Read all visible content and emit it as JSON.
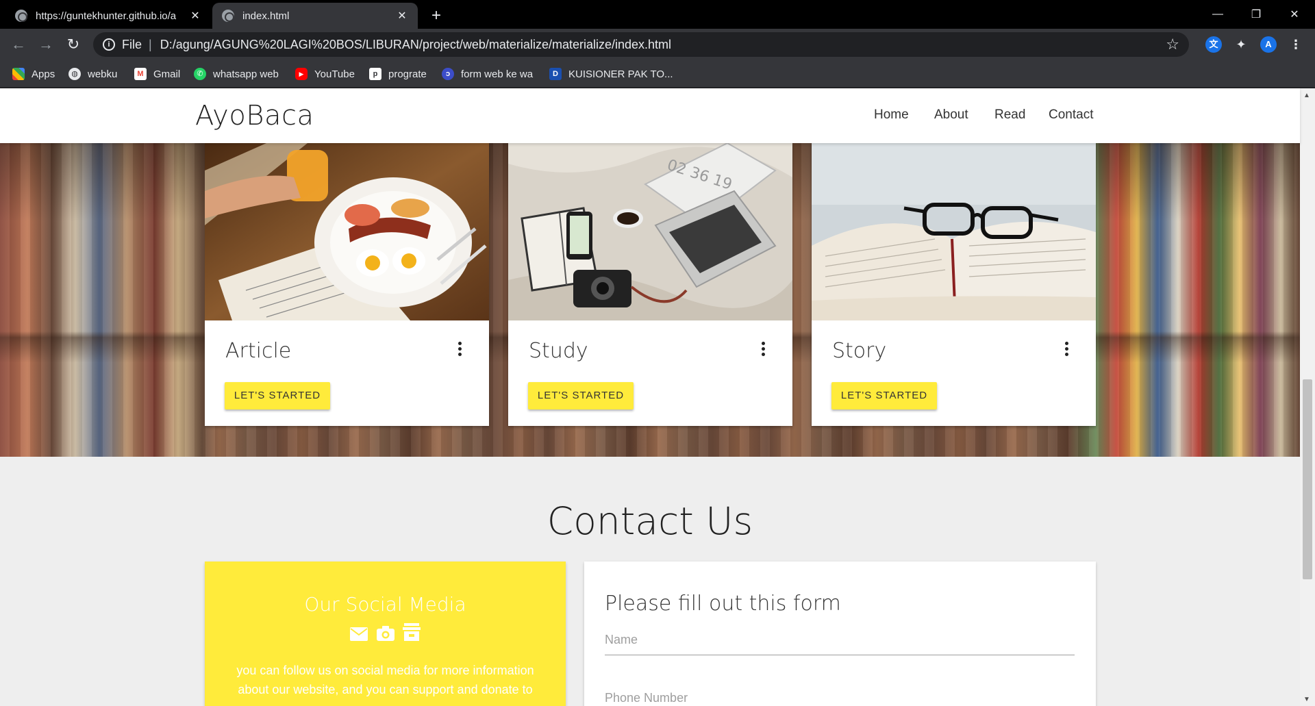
{
  "browser": {
    "tabs": [
      {
        "title": "https://guntekhunter.github.io/a",
        "close": "✕"
      },
      {
        "title": "index.html",
        "close": "✕"
      }
    ],
    "new_tab": "+",
    "window_controls": {
      "minimize": "—",
      "restore": "❐",
      "close": "✕"
    },
    "address": {
      "scheme": "File",
      "url": "D:/agung/AGUNG%20LAGI%20BOS/LIBURAN/project/web/materialize/materialize/index.html"
    },
    "profile_initial": "A",
    "bookmarks": [
      {
        "label": "Apps",
        "icon": "apps-grid-icon"
      },
      {
        "label": "webku",
        "icon": "globe-icon"
      },
      {
        "label": "Gmail",
        "icon": "gmail-icon"
      },
      {
        "label": "whatsapp web",
        "icon": "whatsapp-icon"
      },
      {
        "label": "YouTube",
        "icon": "youtube-icon"
      },
      {
        "label": "prograte",
        "icon": "prograte-icon"
      },
      {
        "label": "form web ke wa",
        "icon": "form-icon"
      },
      {
        "label": "KUISIONER PAK TO...",
        "icon": "docs-icon"
      }
    ]
  },
  "site": {
    "brand": "AyoBaca",
    "menu": [
      "Home",
      "About",
      "Read",
      "Contact"
    ],
    "cards": [
      {
        "title": "Article",
        "button": "LET'S STARTED",
        "image": "breakfast-newspaper"
      },
      {
        "title": "Study",
        "button": "LET'S STARTED",
        "image": "laptop-notebook-camera"
      },
      {
        "title": "Story",
        "button": "LET'S STARTED",
        "image": "open-book-glasses"
      }
    ],
    "contact": {
      "title": "Contact Us",
      "social": {
        "title": "Our Social Media",
        "icons": [
          "mail-icon",
          "camera-icon",
          "store-icon"
        ],
        "text": "you can follow us on social media for more information about our website, and you can support and donate to"
      },
      "form": {
        "title": "Please fill out this form",
        "name_placeholder": "Name",
        "phone_placeholder": "Phone Number"
      }
    }
  },
  "colors": {
    "accent_yellow": "#ffeb3b",
    "chrome_dark": "#35363a",
    "tabbar": "#000000",
    "page_bg": "#eeeeee"
  }
}
